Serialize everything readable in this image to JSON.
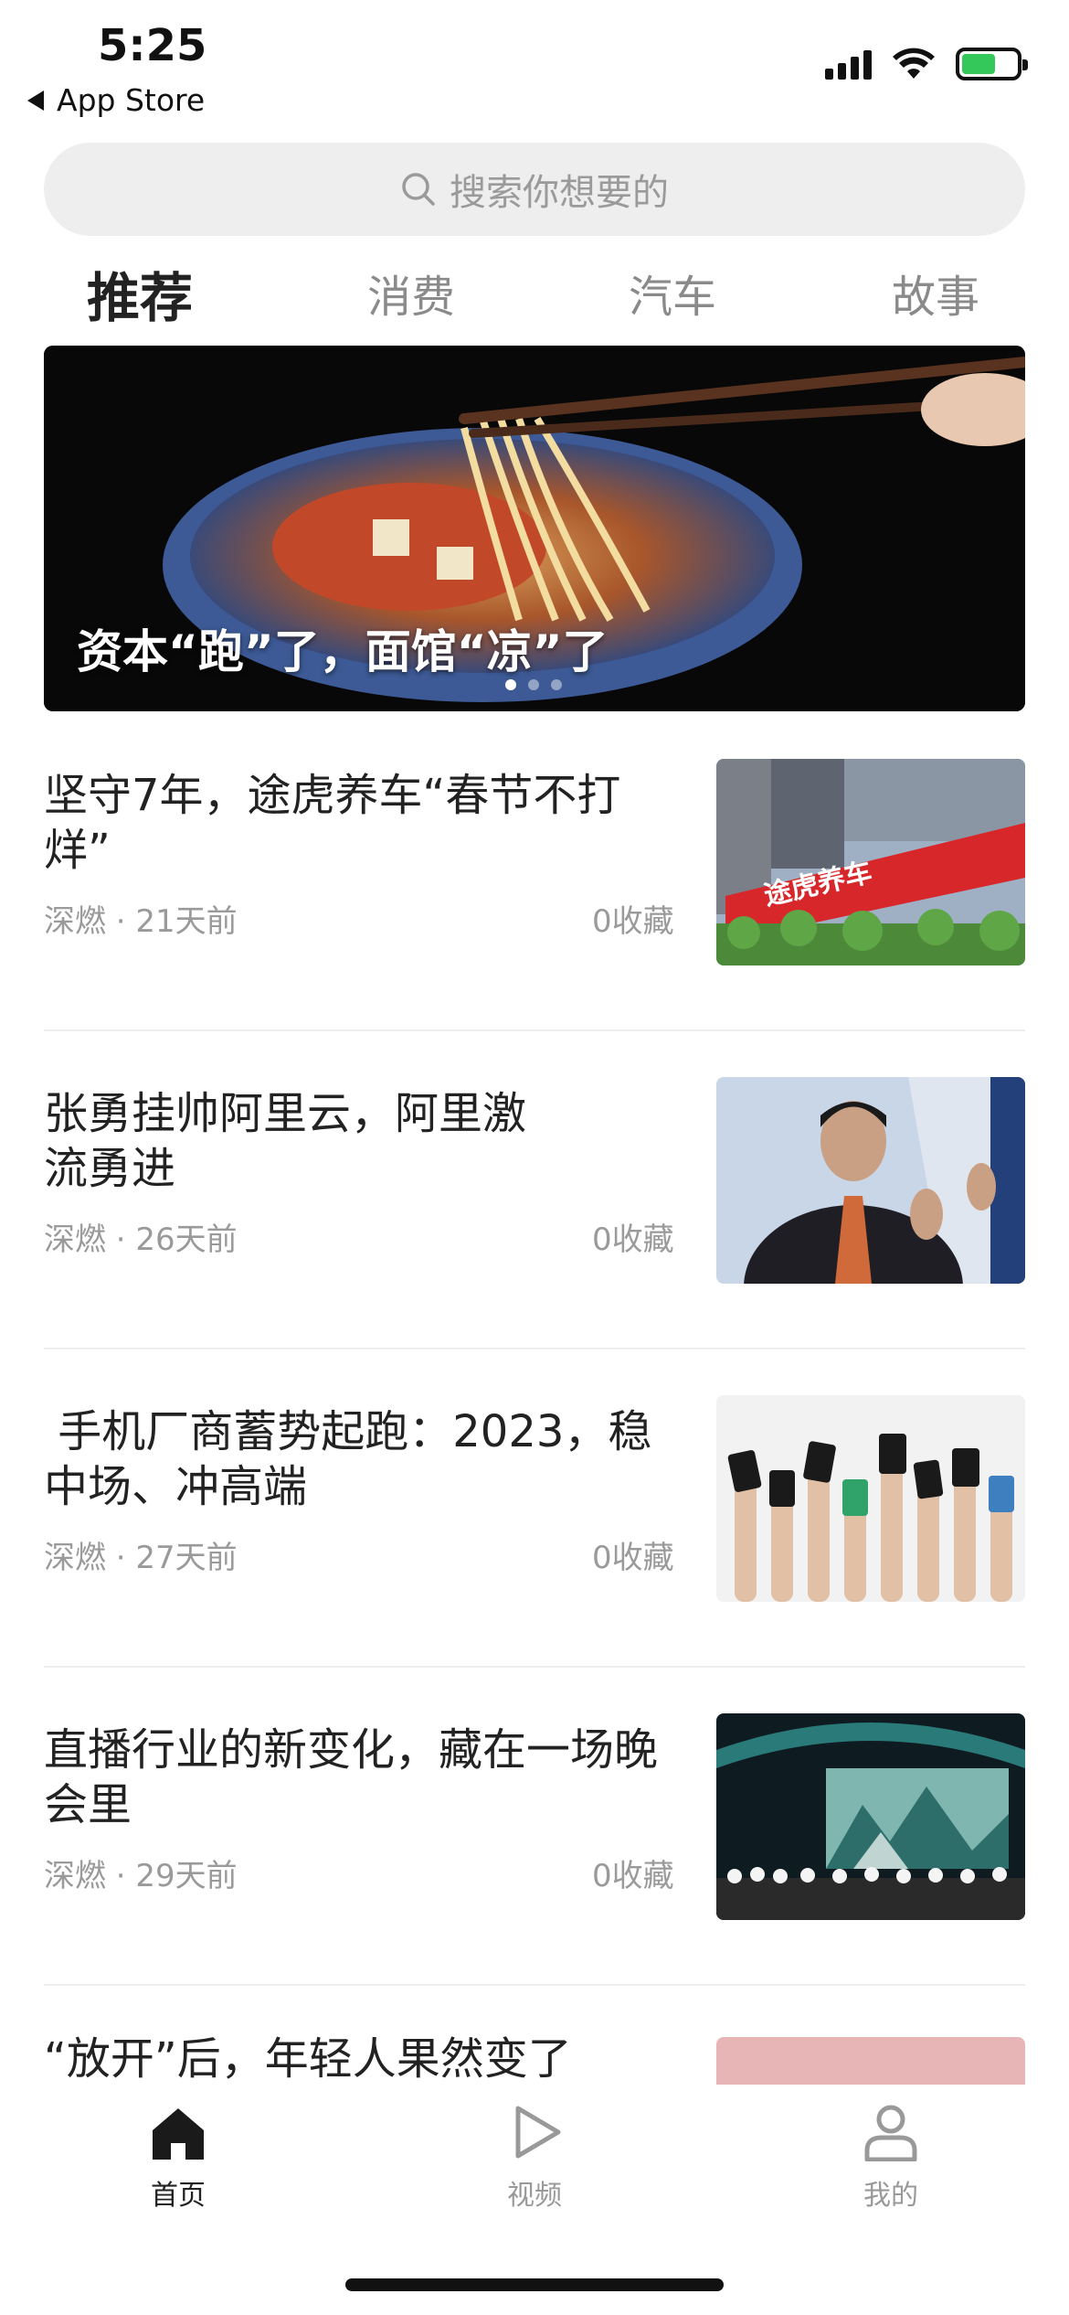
{
  "status_bar": {
    "time": "5:25",
    "back_app": "App Store"
  },
  "search": {
    "placeholder": "搜索你想要的",
    "icon": "search-icon"
  },
  "tabs": [
    {
      "label": "推荐",
      "active": true
    },
    {
      "label": "消费",
      "active": false
    },
    {
      "label": "汽车",
      "active": false
    },
    {
      "label": "故事",
      "active": false
    }
  ],
  "banner": {
    "title": "资本“跑”了，面馆“凉”了",
    "dot_count": 3,
    "active_dot": 1
  },
  "articles": [
    {
      "title": "坚守7年，途虎养车“春节不打烊”",
      "source": "深燃 · 21天前",
      "saves": "0收藏",
      "sign_text": "途虎养车"
    },
    {
      "title": "张勇挂帅阿里云，阿里激流勇进",
      "source": "深燃 · 26天前",
      "saves": "0收藏"
    },
    {
      "title": " 手机厂商蓄势起跑：2023，稳中场、冲高端",
      "source": "深燃 · 27天前",
      "saves": "0收藏"
    },
    {
      "title": "直播行业的新变化，藏在一场晚会里",
      "source": "深燃 · 29天前",
      "saves": "0收藏"
    },
    {
      "title": "“放开”后，年轻人果然变了",
      "source": "",
      "saves": ""
    }
  ],
  "bottom_nav": [
    {
      "label": "首页",
      "icon": "home-icon",
      "active": true
    },
    {
      "label": "视频",
      "icon": "play-icon",
      "active": false
    },
    {
      "label": "我的",
      "icon": "user-icon",
      "active": false
    }
  ],
  "colors": {
    "accent": "#222222",
    "muted": "#9a9a9a",
    "search_bg": "#eeeeee",
    "battery": "#34c759"
  }
}
